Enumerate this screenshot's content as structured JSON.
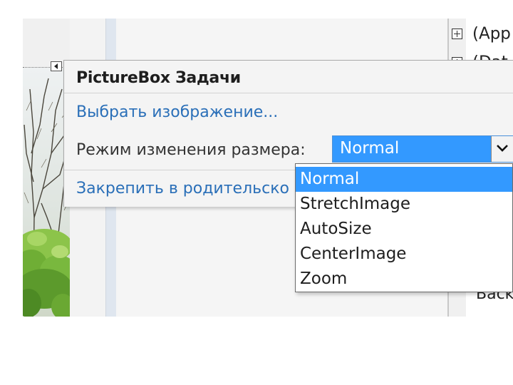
{
  "tasks_panel": {
    "title": "PictureBox Задачи",
    "choose_image_link": "Выбрать изображение...",
    "size_mode_label": "Режим изменения размера:",
    "size_mode_value": "Normal",
    "dock_link": "Закрепить в родительско"
  },
  "size_mode_options": [
    {
      "label": "Normal",
      "selected": true
    },
    {
      "label": "StretchImage",
      "selected": false
    },
    {
      "label": "AutoSize",
      "selected": false
    },
    {
      "label": "CenterImage",
      "selected": false
    },
    {
      "label": "Zoom",
      "selected": false
    }
  ],
  "property_grid": {
    "categories": [
      {
        "label": "(App",
        "expander": "plus-box-icon"
      },
      {
        "label": "(Dat",
        "expander": "plus-box-icon"
      }
    ],
    "rows": [
      {
        "label": "Back"
      }
    ]
  },
  "icons": {
    "smart_tag": "smart-tag-arrow-icon",
    "combo_button": "chevron-down-icon"
  },
  "colors": {
    "selection": "#3399ff",
    "link": "#2a6fb8",
    "panel_background": "#f4f4f4"
  }
}
